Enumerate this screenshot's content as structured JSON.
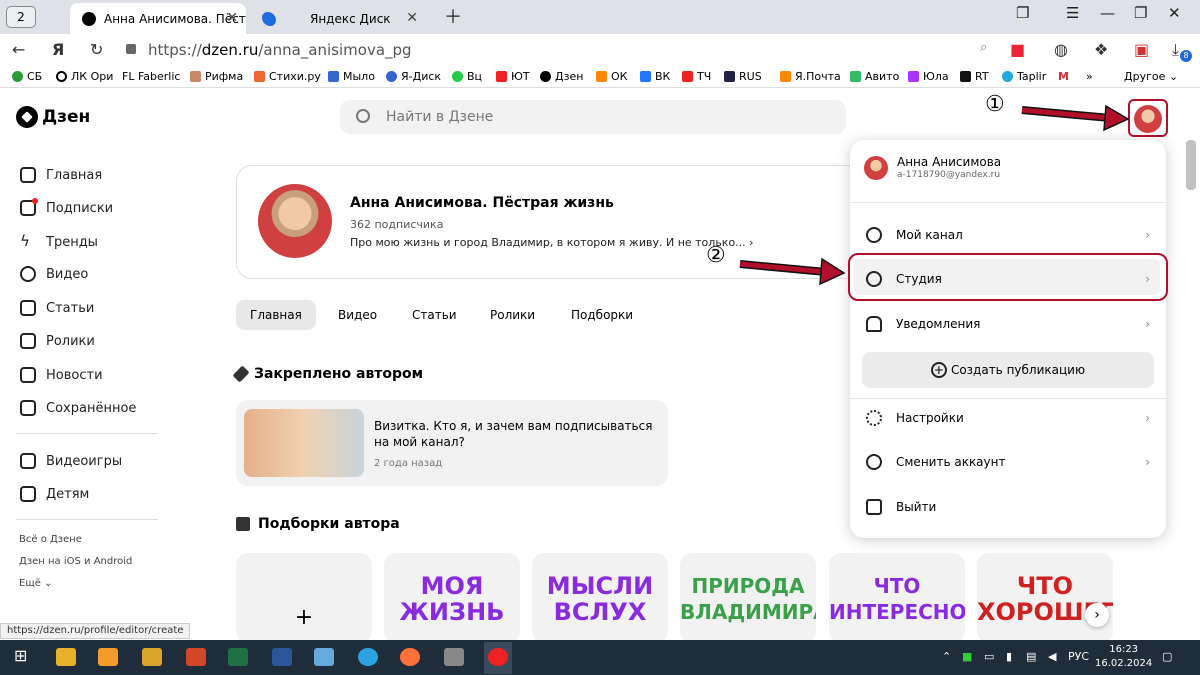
{
  "browser": {
    "tab_count": "2",
    "tabs": [
      {
        "title": "Анна Анисимова. Пёст",
        "active": true
      },
      {
        "title": "Яндекс Диск",
        "active": false
      }
    ],
    "url_scheme": "https://",
    "url_host": "dzen.ru",
    "url_path": "/anna_anisimova_pg",
    "bookmarks": [
      "СБ",
      "ЛК Ори",
      "Faberlic",
      "Рифма",
      "Стихи.ру",
      "Мыло",
      "Я-Диск",
      "Вц",
      "ЮТ",
      "Дзен",
      "ОК",
      "ВК",
      "ТЧ",
      "RUS",
      "Я.Почта",
      "Авито",
      "Юла",
      "RT",
      "Taplir"
    ],
    "bookmarks_more": "Другое",
    "download_badge": "8",
    "status_url": "https://dzen.ru/profile/editor/create"
  },
  "header": {
    "logo": "Дзен",
    "search_placeholder": "Найти в Дзене"
  },
  "sidebar": {
    "items": [
      "Главная",
      "Подписки",
      "Тренды",
      "Видео",
      "Статьи",
      "Ролики",
      "Новости",
      "Сохранённое"
    ],
    "extra": [
      "Видеоигры",
      "Детям"
    ],
    "footer": [
      "Всё о Дзене",
      "Дзен на iOS и Android",
      "Ещё"
    ]
  },
  "channel": {
    "title": "Анна Анисимова. Пёстрая жизнь",
    "subscribers": "362 подписчика",
    "description": "Про мою жизнь и город Владимир, в котором я живу. И не только..."
  },
  "page_tabs": [
    "Главная",
    "Видео",
    "Статьи",
    "Ролики",
    "Подборки"
  ],
  "pinned": {
    "heading": "Закреплено автором",
    "title": "Визитка. Кто я, и зачем вам подписываться на мой канал?",
    "date": "2 года назад"
  },
  "collections": {
    "heading": "Подборки автора",
    "add": "+",
    "items": [
      "МОЯ ЖИЗНЬ",
      "МЫСЛИ ВСЛУХ",
      "ПРИРОДА ВЛАДИМИРА",
      "ЧТО ИНТЕРЕСНОГО",
      "ЧТО ХОРОШЕГО"
    ],
    "colors": [
      "#8a2be2",
      "#8a2be2",
      "#3aa04a",
      "#8a2be2",
      "#d02020"
    ]
  },
  "menu": {
    "user_name": "Анна Анисимова",
    "user_email": "a-1718790@yandex.ru",
    "items": [
      "Мой канал",
      "Студия",
      "Уведомления"
    ],
    "create": "Создать публикацию",
    "items2": [
      "Настройки",
      "Сменить аккаунт",
      "Выйти"
    ]
  },
  "annotations": {
    "one": "①",
    "two": "②"
  },
  "taskbar": {
    "lang": "РУС",
    "time": "16:23",
    "date": "16.02.2024"
  },
  "colors": {
    "annotation_red": "#b2102a"
  }
}
